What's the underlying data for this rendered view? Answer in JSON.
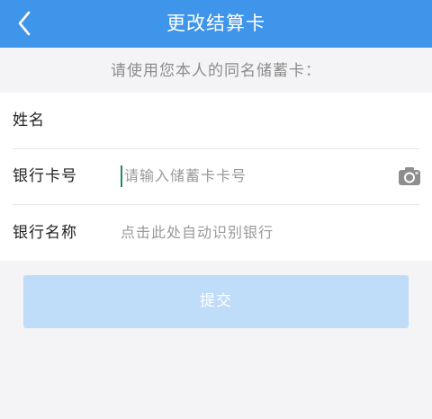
{
  "header": {
    "back_icon": "chevron-left-icon",
    "title": "更改结算卡",
    "bg_color": "#3f95ea"
  },
  "hint": "请使用您本人的同名储蓄卡：",
  "form": {
    "name": {
      "label": "姓名",
      "value": ""
    },
    "card_number": {
      "label": "银行卡号",
      "placeholder": "请输入储蓄卡卡号",
      "camera_icon": "camera-icon"
    },
    "bank_name": {
      "label": "银行名称",
      "placeholder": "点击此处自动识别银行"
    }
  },
  "submit": {
    "label": "提交",
    "color": "#bfdcf8"
  }
}
